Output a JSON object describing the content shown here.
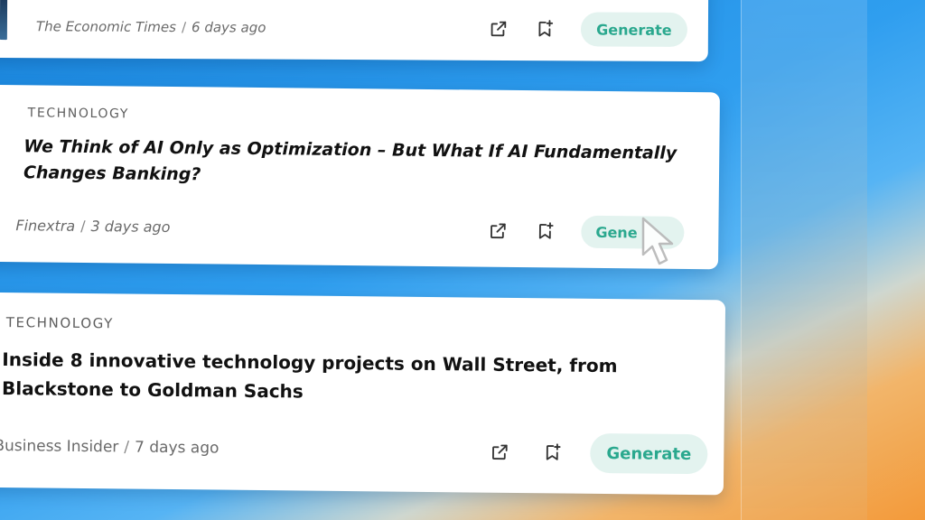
{
  "articles": [
    {
      "category": "",
      "title_line1": "",
      "title_line2": "",
      "source": "The Economic Times",
      "time": "6 days ago",
      "generate_label": "Generate"
    },
    {
      "category": "TECHNOLOGY",
      "title_line1": "We Think of AI Only as Optimization – But What If AI Fundamentally",
      "title_line2": "Changes Banking?",
      "source": "Finextra",
      "time": "3 days ago",
      "generate_label": "Gene"
    },
    {
      "category": "TECHNOLOGY",
      "title_line1": "Inside 8 innovative technology projects on Wall Street, from",
      "title_line2": "Blackstone to Goldman Sachs",
      "source": "Business Insider",
      "time": "7 days ago",
      "generate_label": "Generate"
    }
  ],
  "separator": "/",
  "icons": {
    "open": "external-link-icon",
    "bookmark": "bookmark-add-icon",
    "cursor": "mouse-pointer-icon"
  },
  "colors": {
    "generate_bg": "#e3f3ef",
    "generate_text": "#2aa88e",
    "card_bg": "#ffffff"
  }
}
